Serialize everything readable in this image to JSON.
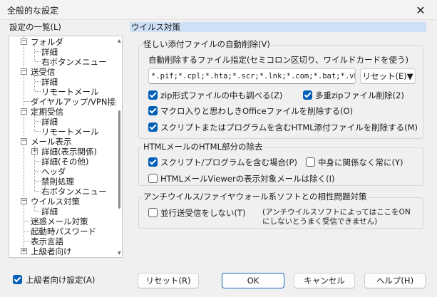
{
  "window": {
    "title": "全般的な設定",
    "close_glyph": "✕"
  },
  "tree": {
    "label": "設定の一覧(L)",
    "nodes": [
      {
        "label": "フォルダ"
      },
      {
        "label": "詳細"
      },
      {
        "label": "右ボタンメニュー"
      },
      {
        "label": "送受信"
      },
      {
        "label": "詳細"
      },
      {
        "label": "リモートメール"
      },
      {
        "label": "ダイヤルアップ/VPN接続"
      },
      {
        "label": "定期受信"
      },
      {
        "label": "詳細"
      },
      {
        "label": "リモートメール"
      },
      {
        "label": "メール表示"
      },
      {
        "label": "詳細(表示関係)"
      },
      {
        "label": "詳細(その他)"
      },
      {
        "label": "ヘッダ"
      },
      {
        "label": "禁則処理"
      },
      {
        "label": "右ボタンメニュー"
      },
      {
        "label": "ウイルス対策"
      },
      {
        "label": "詳細"
      },
      {
        "label": "迷惑メール対策"
      },
      {
        "label": "起動時パスワード"
      },
      {
        "label": "表示言語"
      },
      {
        "label": "上級者向け"
      }
    ]
  },
  "advanced_setting": {
    "label": "上級者向け設定(A)",
    "checked": true
  },
  "panel": {
    "title": "ウイルス対策",
    "suspicious": {
      "label": "怪しい添付ファイルの自動削除(V)",
      "files_label": "自動削除するファイル指定(セミコロン区切り、ワイルドカードを使う)",
      "files_value": "*.pif;*.cpl;*.hta;*.scr;*.lnk;*.com;*.bat;*.vbs;",
      "reset_label": "リセット(E)▼",
      "zip_check": "zip形式ファイルの中も調べる(Z)",
      "multi_zip": "多重zipファイル削除(2)",
      "macro": "マクロ入りと思わしきOfficeファイルを削除する(O)",
      "script": "スクリプトまたはプログラムを含むHTML添付ファイルを削除する(M)"
    },
    "html_mail": {
      "label": "HTMLメールのHTML部分の除去",
      "script_prog": "スクリプト/プログラムを含む場合(P)",
      "always": "中身に関係なく常に(Y)",
      "viewer": "HTMLメールViewerの表示対象メールは除く(I)"
    },
    "antivirus": {
      "label": "アンチウイルス/ファイヤウォール系ソフトとの相性問題対策",
      "parallel": "並行送受信をしない(T)",
      "note_line1": "(アンチウイルスソフトによってはここをON",
      "note_line2": "にしないとうまく受信できません)"
    }
  },
  "buttons": {
    "reset": "リセット(R)",
    "ok": "OK",
    "cancel": "キャンセル",
    "help": "ヘルプ(H)"
  }
}
